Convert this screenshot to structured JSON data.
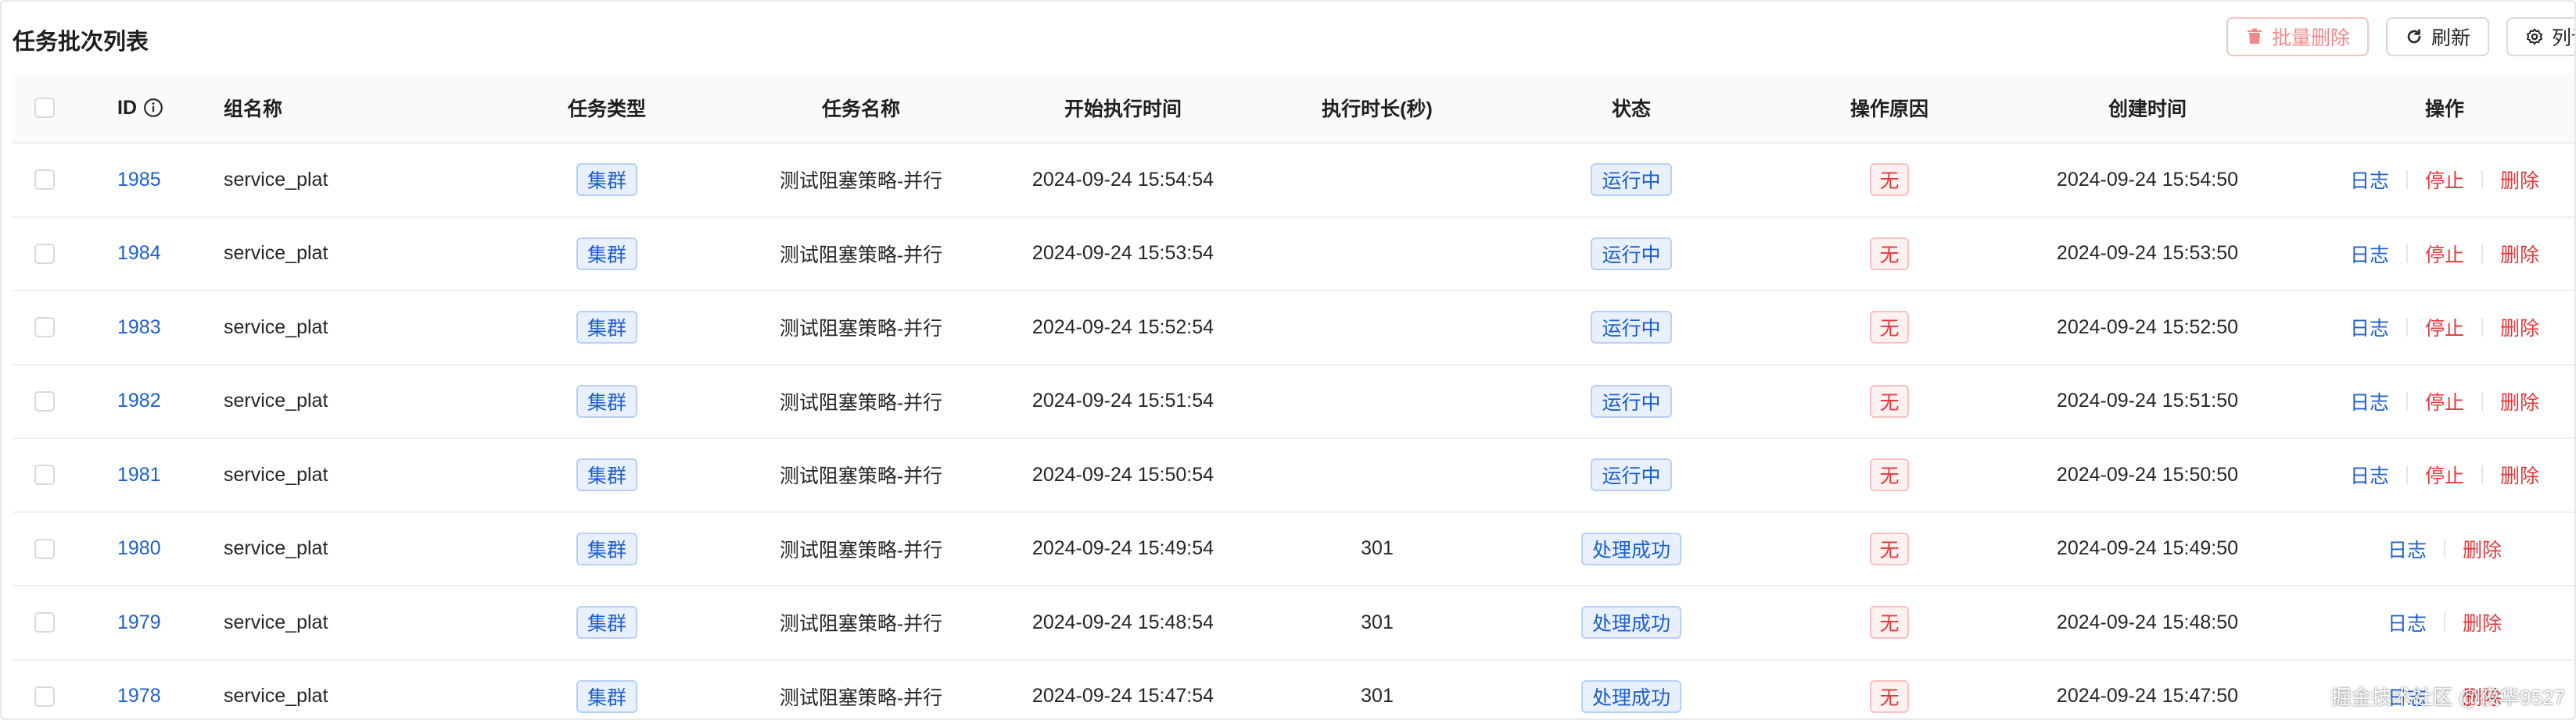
{
  "header": {
    "title": "任务批次列表",
    "batch_delete_label": "批量删除",
    "refresh_label": "刷新",
    "column_settings_label": "列设置"
  },
  "table": {
    "columns": [
      "ID",
      "组名称",
      "任务类型",
      "任务名称",
      "开始执行时间",
      "执行时长(秒)",
      "状态",
      "操作原因",
      "创建时间",
      "操作"
    ],
    "rows": [
      {
        "id": "1985",
        "group": "service_plat",
        "type": "集群",
        "name": "测试阻塞策略-并行",
        "start": "2024-09-24 15:54:54",
        "duration": "",
        "status": "运行中",
        "reason": "无",
        "created": "2024-09-24 15:54:50",
        "actions": [
          "日志",
          "停止",
          "删除"
        ]
      },
      {
        "id": "1984",
        "group": "service_plat",
        "type": "集群",
        "name": "测试阻塞策略-并行",
        "start": "2024-09-24 15:53:54",
        "duration": "",
        "status": "运行中",
        "reason": "无",
        "created": "2024-09-24 15:53:50",
        "actions": [
          "日志",
          "停止",
          "删除"
        ]
      },
      {
        "id": "1983",
        "group": "service_plat",
        "type": "集群",
        "name": "测试阻塞策略-并行",
        "start": "2024-09-24 15:52:54",
        "duration": "",
        "status": "运行中",
        "reason": "无",
        "created": "2024-09-24 15:52:50",
        "actions": [
          "日志",
          "停止",
          "删除"
        ]
      },
      {
        "id": "1982",
        "group": "service_plat",
        "type": "集群",
        "name": "测试阻塞策略-并行",
        "start": "2024-09-24 15:51:54",
        "duration": "",
        "status": "运行中",
        "reason": "无",
        "created": "2024-09-24 15:51:50",
        "actions": [
          "日志",
          "停止",
          "删除"
        ]
      },
      {
        "id": "1981",
        "group": "service_plat",
        "type": "集群",
        "name": "测试阻塞策略-并行",
        "start": "2024-09-24 15:50:54",
        "duration": "",
        "status": "运行中",
        "reason": "无",
        "created": "2024-09-24 15:50:50",
        "actions": [
          "日志",
          "停止",
          "删除"
        ]
      },
      {
        "id": "1980",
        "group": "service_plat",
        "type": "集群",
        "name": "测试阻塞策略-并行",
        "start": "2024-09-24 15:49:54",
        "duration": "301",
        "status": "处理成功",
        "reason": "无",
        "created": "2024-09-24 15:49:50",
        "actions": [
          "日志",
          "删除"
        ]
      },
      {
        "id": "1979",
        "group": "service_plat",
        "type": "集群",
        "name": "测试阻塞策略-并行",
        "start": "2024-09-24 15:48:54",
        "duration": "301",
        "status": "处理成功",
        "reason": "无",
        "created": "2024-09-24 15:48:50",
        "actions": [
          "日志",
          "删除"
        ]
      },
      {
        "id": "1978",
        "group": "service_plat",
        "type": "集群",
        "name": "测试阻塞策略-并行",
        "start": "2024-09-24 15:47:54",
        "duration": "301",
        "status": "处理成功",
        "reason": "无",
        "created": "2024-09-24 15:47:50",
        "actions": [
          "日志",
          "删除"
        ]
      }
    ]
  },
  "watermark": "掘金技术社区 @夜华9527",
  "colors": {
    "link_blue": "#1d5fd1",
    "danger_red": "#e5373b",
    "tag_blue_bg": "#e8f0fe",
    "tag_red_bg": "#fff1f0"
  },
  "icons": {
    "batch_delete": "trash-icon",
    "refresh": "refresh-icon",
    "column_settings": "gear-icon",
    "id_info": "info-circle-icon"
  }
}
